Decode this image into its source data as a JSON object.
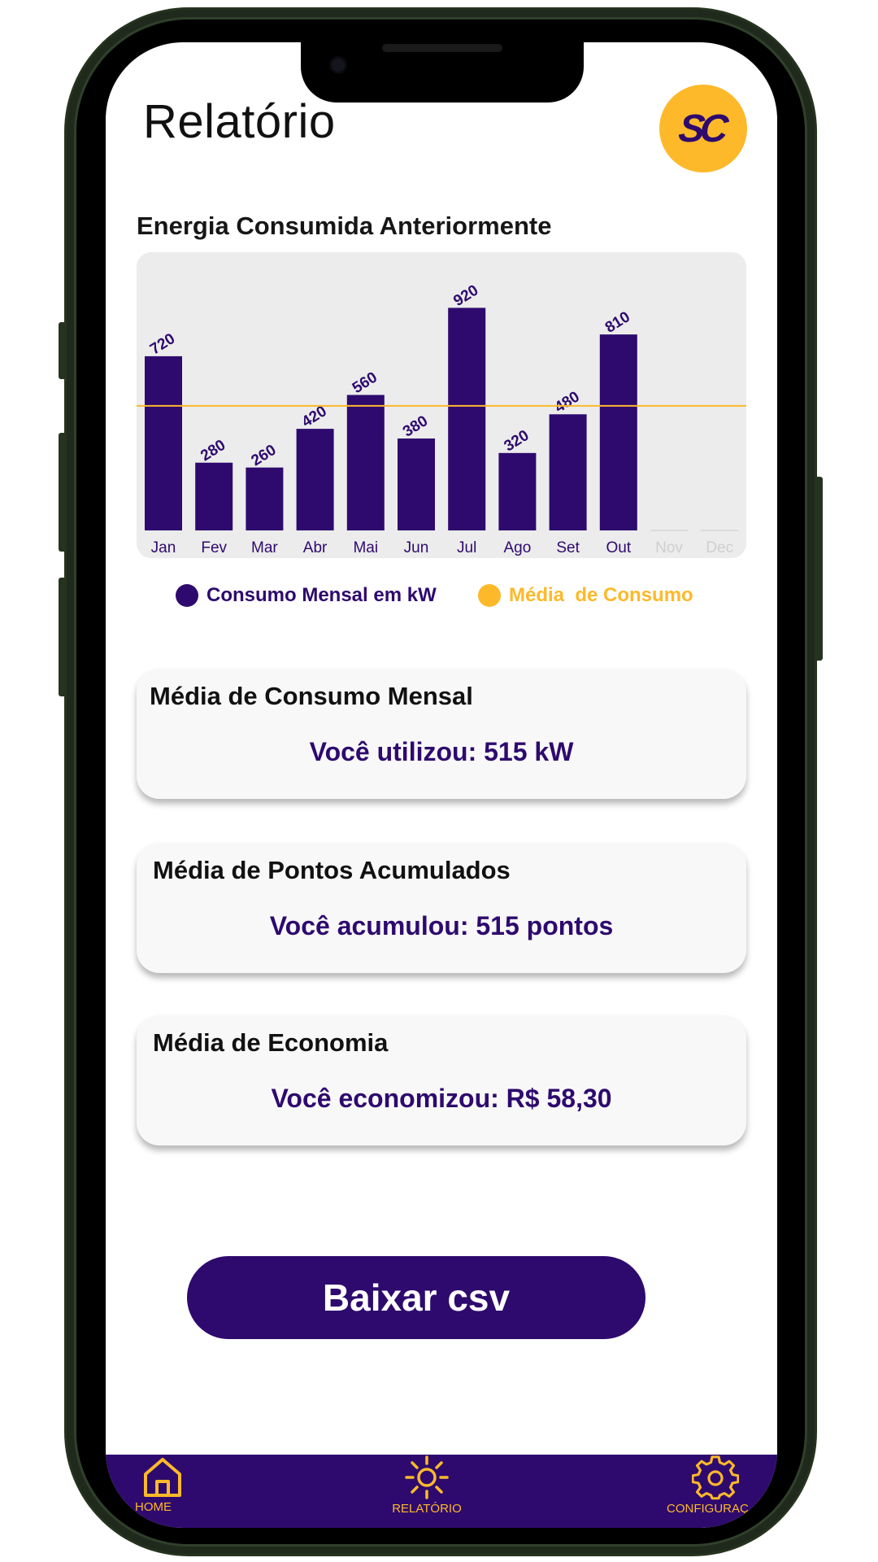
{
  "header": {
    "title": "Relatório",
    "avatar_initials": "SC"
  },
  "chart_section": {
    "title": "Energia Consumida Anteriormente"
  },
  "legend": {
    "consumo_label": "Consumo Mensal em kW",
    "media_label": "Média  de Consumo"
  },
  "chart_data": {
    "type": "bar",
    "categories": [
      "Jan",
      "Fev",
      "Mar",
      "Abr",
      "Mai",
      "Jun",
      "Jul",
      "Ago",
      "Set",
      "Out",
      "Nov",
      "Dec"
    ],
    "series": [
      {
        "name": "Consumo Mensal em kW",
        "values": [
          720,
          280,
          260,
          420,
          560,
          380,
          920,
          320,
          480,
          810,
          null,
          null
        ]
      }
    ],
    "reference_line": {
      "name": "Média  de Consumo",
      "value": 515
    },
    "ylim": [
      0,
      1150
    ],
    "grid": false,
    "legend_position": "bottom"
  },
  "cards": [
    {
      "title": "Média de Consumo Mensal",
      "value": "Você utilizou: 515 kW"
    },
    {
      "title": "Média de Pontos Acumulados",
      "value": "Você acumulou: 515 pontos"
    },
    {
      "title": "Média de Economia",
      "value": "Você economizou: R$ 58,30"
    }
  ],
  "actions": {
    "download_label": "Baixar csv"
  },
  "nav": {
    "items": [
      {
        "label": "HOME",
        "icon": "home-icon"
      },
      {
        "label": "RELATÓRIO",
        "icon": "sun-icon"
      },
      {
        "label": "CONFIGURAÇ",
        "icon": "gear-icon"
      }
    ]
  },
  "colors": {
    "primary": "#2e0a6e",
    "accent": "#fdb92a",
    "chart_bg": "#ececec",
    "disabled_label": "#cfcfcf"
  }
}
